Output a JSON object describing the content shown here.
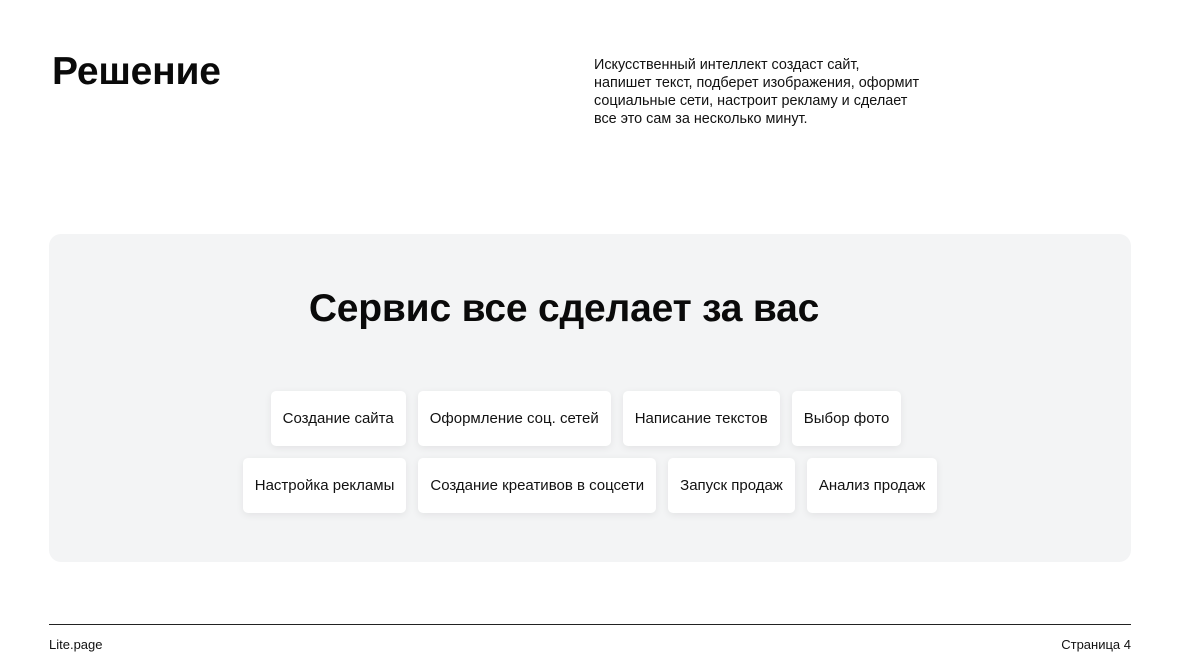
{
  "header": {
    "title": "Решение",
    "intro_lines": [
      "Искусственный интеллект создаст сайт,",
      "напишет текст, подберет изображения, оформит",
      "социальные сети, настроит рекламу и сделает",
      "все это сам за несколько минут."
    ]
  },
  "panel": {
    "title": "Сервис все сделает за вас",
    "rows": [
      [
        "Создание сайта",
        "Оформление соц. сетей",
        "Написание текстов",
        "Выбор фото"
      ],
      [
        "Настройка рекламы",
        "Создание креативов в соцсети",
        "Запуск продаж",
        "Анализ продаж"
      ]
    ]
  },
  "footer": {
    "brand": "Lite.page",
    "page": "Страница 4"
  },
  "colors": {
    "panel_background": "#f3f4f5",
    "chip_background": "#ffffff",
    "text": "#0a0a0a"
  }
}
